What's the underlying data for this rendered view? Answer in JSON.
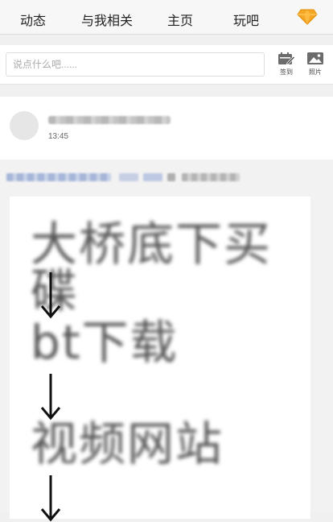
{
  "nav": {
    "tabs": [
      "动态",
      "与我相关",
      "主页",
      "玩吧"
    ],
    "vip_icon": "diamond-icon",
    "vip_color": "#f5a623"
  },
  "composer": {
    "placeholder": "说点什么吧......",
    "checkin_label": "签到",
    "photo_label": "照片"
  },
  "post": {
    "time": "13:45"
  },
  "image": {
    "line1": "大桥底下买碟",
    "line2": "bt下载",
    "line3": "视频网站"
  }
}
